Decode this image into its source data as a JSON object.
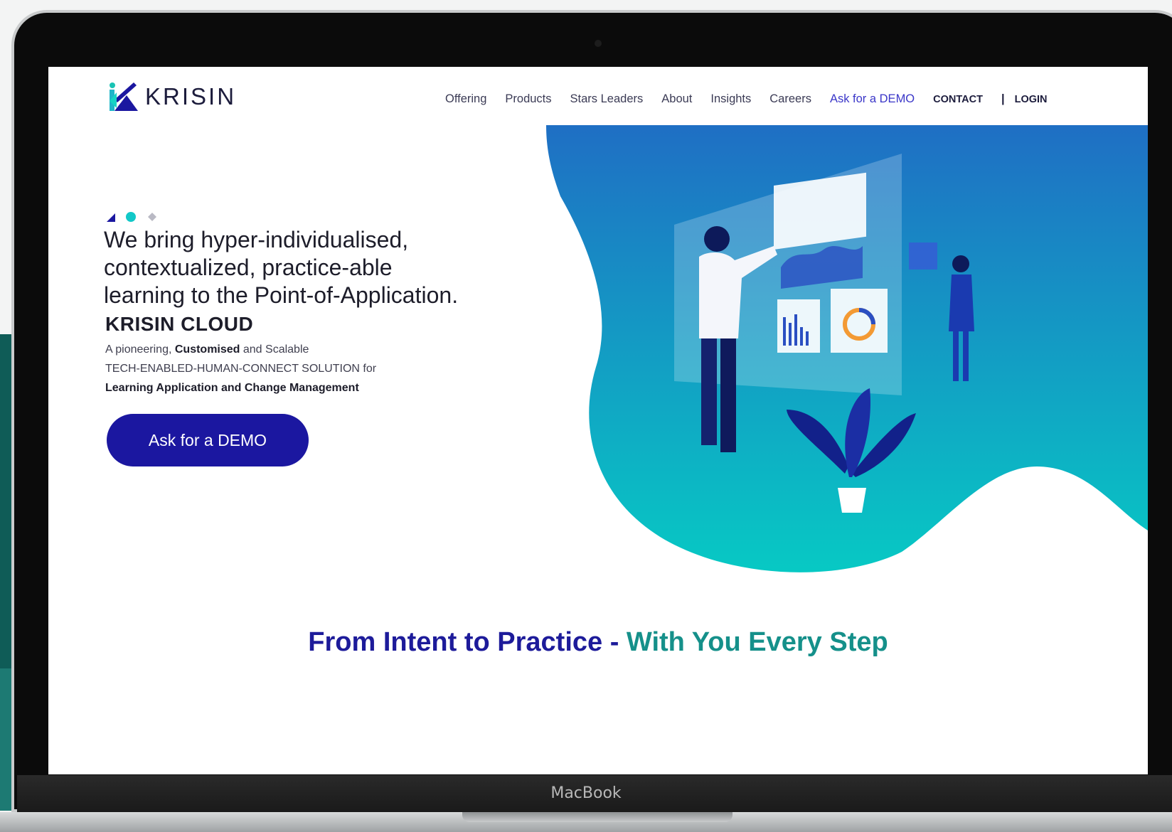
{
  "device": {
    "label": "MacBook"
  },
  "brand": {
    "name": "KRISIN"
  },
  "nav": {
    "items": [
      "Offering",
      "Products",
      "Stars Leaders",
      "About",
      "Insights",
      "Careers"
    ],
    "demo": "Ask for a DEMO",
    "contact": "CONTACT",
    "separator": "|",
    "login": "LOGIN"
  },
  "hero": {
    "headline": [
      "We bring hyper-individualised,",
      "contextualized, practice-able",
      "learning to the Point-of-Application."
    ],
    "product_title": "KRISIN CLOUD",
    "desc_line1_a": "A pioneering, ",
    "desc_line1_b": "Customised",
    "desc_line1_c": " and Scalable",
    "desc_line2": "TECH-ENABLED-HUMAN-CONNECT SOLUTION for",
    "desc_line3": "Learning Application and Change Management",
    "cta": "Ask for a DEMO"
  },
  "tagline": {
    "part1": "From Intent to Practice - ",
    "part2": "With You Every Step"
  },
  "colors": {
    "primary": "#1b17a0",
    "teal": "#15908a",
    "blob_top": "#1f6fc4",
    "blob_bottom": "#07c9c4"
  }
}
